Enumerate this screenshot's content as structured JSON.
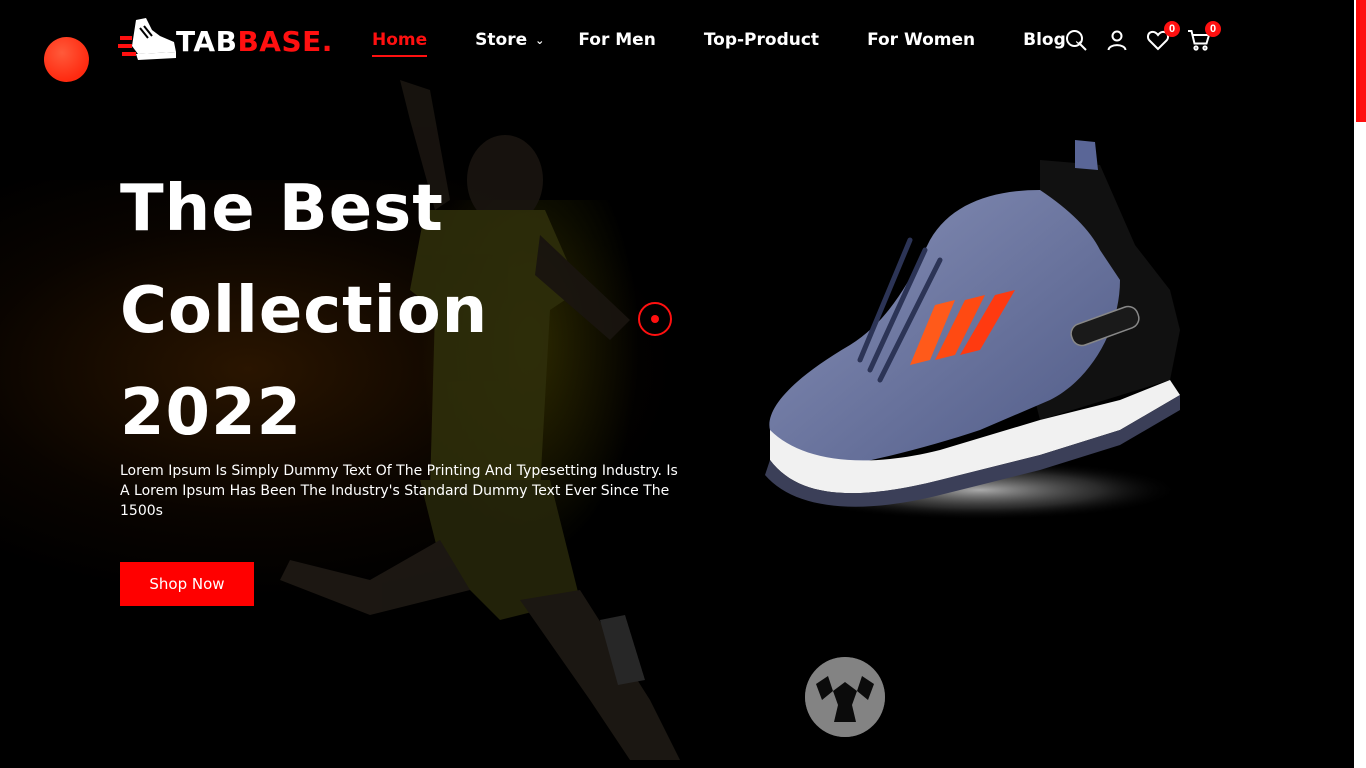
{
  "brand": {
    "logo_white": "TAB",
    "logo_red": "BASE."
  },
  "nav": {
    "items": [
      {
        "label": "Home",
        "active": true,
        "has_dropdown": false
      },
      {
        "label": "Store",
        "active": false,
        "has_dropdown": true
      },
      {
        "label": "For Men",
        "active": false,
        "has_dropdown": false
      },
      {
        "label": "Top-Product",
        "active": false,
        "has_dropdown": false
      },
      {
        "label": "For Women",
        "active": false,
        "has_dropdown": false
      },
      {
        "label": "Blog",
        "active": false,
        "has_dropdown": true
      }
    ]
  },
  "header_icons": {
    "search": "search-icon",
    "account": "user-icon",
    "wishlist": {
      "icon": "heart-icon",
      "count": "0"
    },
    "cart": {
      "icon": "cart-icon",
      "count": "0"
    }
  },
  "hero": {
    "title_line1": "The Best",
    "title_line2": "Collection",
    "title_line3": "2022",
    "description": "Lorem Ipsum Is Simply Dummy Text Of The Printing And Typesetting Industry. Is A Lorem Ipsum Has Been The Industry's Standard Dummy Text Ever Since The 1500s",
    "cta_label": "Shop Now"
  },
  "colors": {
    "accent": "#ff1010",
    "background": "#000000",
    "text": "#ffffff"
  }
}
